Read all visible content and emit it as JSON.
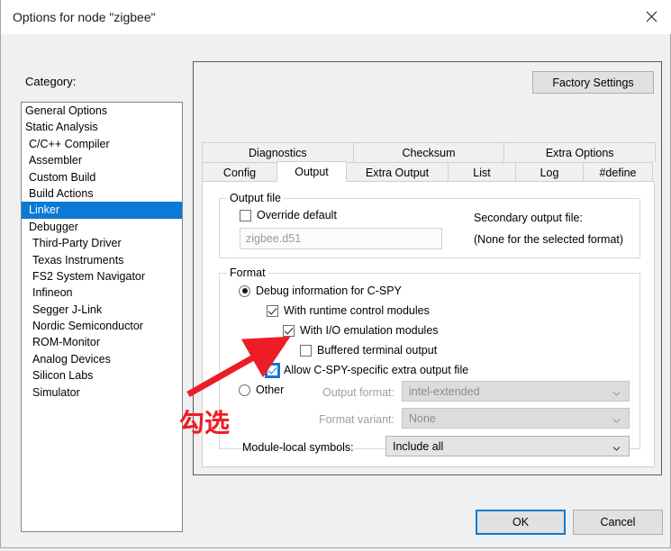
{
  "window": {
    "title": "Options for node \"zigbee\"",
    "close_icon": "close-icon"
  },
  "category": {
    "label": "Category:",
    "items": [
      {
        "label": "General Options",
        "indent": 0,
        "selected": false
      },
      {
        "label": "Static Analysis",
        "indent": 0,
        "selected": false
      },
      {
        "label": "C/C++ Compiler",
        "indent": 1,
        "selected": false
      },
      {
        "label": "Assembler",
        "indent": 1,
        "selected": false
      },
      {
        "label": "Custom Build",
        "indent": 1,
        "selected": false
      },
      {
        "label": "Build Actions",
        "indent": 1,
        "selected": false
      },
      {
        "label": "Linker",
        "indent": 1,
        "selected": true
      },
      {
        "label": "Debugger",
        "indent": 1,
        "selected": false
      },
      {
        "label": "Third-Party Driver",
        "indent": 2,
        "selected": false
      },
      {
        "label": "Texas Instruments",
        "indent": 2,
        "selected": false
      },
      {
        "label": "FS2 System Navigator",
        "indent": 2,
        "selected": false
      },
      {
        "label": "Infineon",
        "indent": 2,
        "selected": false
      },
      {
        "label": "Segger J-Link",
        "indent": 2,
        "selected": false
      },
      {
        "label": "Nordic Semiconductor",
        "indent": 2,
        "selected": false
      },
      {
        "label": "ROM-Monitor",
        "indent": 2,
        "selected": false
      },
      {
        "label": "Analog Devices",
        "indent": 2,
        "selected": false
      },
      {
        "label": "Silicon Labs",
        "indent": 2,
        "selected": false
      },
      {
        "label": "Simulator",
        "indent": 2,
        "selected": false
      }
    ]
  },
  "panel": {
    "factory_settings_label": "Factory Settings",
    "tabs_row1": [
      {
        "label": "Diagnostics",
        "selected": false
      },
      {
        "label": "Checksum",
        "selected": false
      },
      {
        "label": "Extra Options",
        "selected": false
      }
    ],
    "tabs_row2": [
      {
        "label": "Config",
        "selected": false
      },
      {
        "label": "Output",
        "selected": true
      },
      {
        "label": "Extra Output",
        "selected": false
      },
      {
        "label": "List",
        "selected": false
      },
      {
        "label": "Log",
        "selected": false
      },
      {
        "label": "#define",
        "selected": false
      }
    ]
  },
  "output_file": {
    "group_title": "Output file",
    "override_default_label": "Override default",
    "override_default_checked": false,
    "filename_value": "zigbee.d51",
    "secondary_label": "Secondary output file:",
    "secondary_value": "(None for the selected format)"
  },
  "format": {
    "group_title": "Format",
    "debug_info_label": "Debug information for C-SPY",
    "debug_info_selected": true,
    "runtime_control_label": "With runtime control modules",
    "runtime_control_checked": true,
    "io_emulation_label": "With I/O emulation modules",
    "io_emulation_checked": true,
    "buffered_terminal_label": "Buffered terminal output",
    "buffered_terminal_checked": false,
    "allow_cspy_label": "Allow C-SPY-specific extra output file",
    "allow_cspy_checked": true,
    "allow_cspy_focused": true,
    "other_label": "Other",
    "other_selected": false,
    "output_format_label": "Output format:",
    "output_format_value": "intel-extended",
    "output_format_enabled": false,
    "format_variant_label": "Format variant:",
    "format_variant_value": "None",
    "format_variant_enabled": false,
    "module_local_label": "Module-local symbols:",
    "module_local_value": "Include all",
    "module_local_enabled": true
  },
  "buttons": {
    "ok_label": "OK",
    "cancel_label": "Cancel"
  },
  "annotation": {
    "text": "勾选",
    "color": "#ee1c25",
    "arrow_icon": "arrow-icon"
  }
}
